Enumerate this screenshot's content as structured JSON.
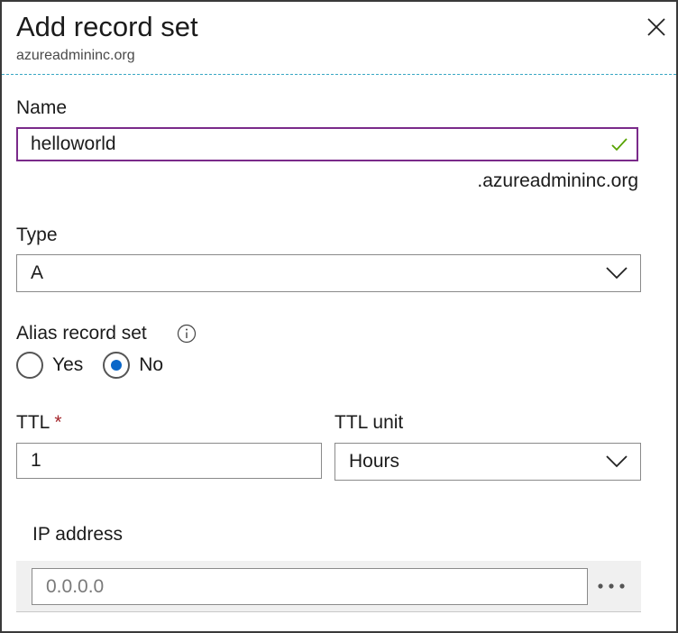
{
  "header": {
    "title": "Add record set",
    "subtitle": "azureadmininc.org"
  },
  "form": {
    "name_label": "Name",
    "name_value": "helloworld",
    "name_suffix": ".azureadmininc.org",
    "type_label": "Type",
    "type_value": "A",
    "alias_label": "Alias record set",
    "alias_options": [
      "Yes",
      "No"
    ],
    "alias_selected": "No",
    "ttl_label": "TTL",
    "ttl_required_mark": "*",
    "ttl_value": "1",
    "ttl_unit_label": "TTL unit",
    "ttl_unit_value": "Hours",
    "ip_label": "IP address",
    "ip_placeholder": "0.0.0.0"
  },
  "colors": {
    "focus_border": "#7a2a8a",
    "check_green": "#57a300",
    "radio_selected": "#0a67c9",
    "required_red": "#a4262c"
  },
  "icons": {
    "close": "close-icon",
    "valid": "checkmark-icon",
    "dropdown": "chevron-down-icon",
    "info": "info-icon",
    "more": "ellipsis-icon"
  }
}
